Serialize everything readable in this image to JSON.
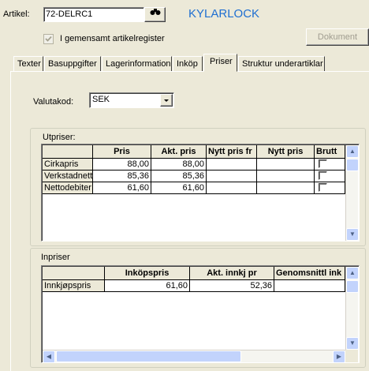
{
  "header": {
    "artikel_label": "Artikel:",
    "artikel_value": "72-DELRC1",
    "article_name": "KYLARLOCK",
    "shared_register_label": "I gemensamt artikelregister",
    "shared_register_checked": true,
    "dokument_button": "Dokument"
  },
  "tabs": [
    {
      "label": "Texter",
      "active": false
    },
    {
      "label": "Basuppgifter",
      "active": false
    },
    {
      "label": "Lagerinformation",
      "active": false
    },
    {
      "label": "Inköp",
      "active": false
    },
    {
      "label": "Priser",
      "active": true
    },
    {
      "label": "Struktur underartiklar",
      "active": false
    }
  ],
  "currency": {
    "label": "Valutakod:",
    "value": "SEK"
  },
  "utpriser": {
    "title": "Utpriser:",
    "columns": [
      "Pris",
      "Akt. pris",
      "Nytt pris fr",
      "Nytt pris",
      "Brutt"
    ],
    "rows": [
      {
        "name": "Cirkapris",
        "pris": "88,00",
        "akt_pris": "88,00",
        "nytt_pris_fr": "",
        "nytt_pris": "",
        "brutto": false
      },
      {
        "name": "Verkstadnett",
        "pris": "85,36",
        "akt_pris": "85,36",
        "nytt_pris_fr": "",
        "nytt_pris": "",
        "brutto": false
      },
      {
        "name": "Nettodebiter",
        "pris": "61,60",
        "akt_pris": "61,60",
        "nytt_pris_fr": "",
        "nytt_pris": "",
        "brutto": false
      }
    ]
  },
  "inpriser": {
    "title": "Inpriser",
    "columns": [
      "Inköpspris",
      "Akt. innkj pr",
      "Genomsnittl ink"
    ],
    "rows": [
      {
        "name": "Innkjøpspris",
        "inkopspris": "61,60",
        "akt_innkj_pr": "52,36",
        "genomsnittl": ""
      }
    ]
  },
  "colors": {
    "background": "#ece9d8",
    "title_text": "#1f6fd1",
    "scrollbar": "#c2d3fc"
  }
}
